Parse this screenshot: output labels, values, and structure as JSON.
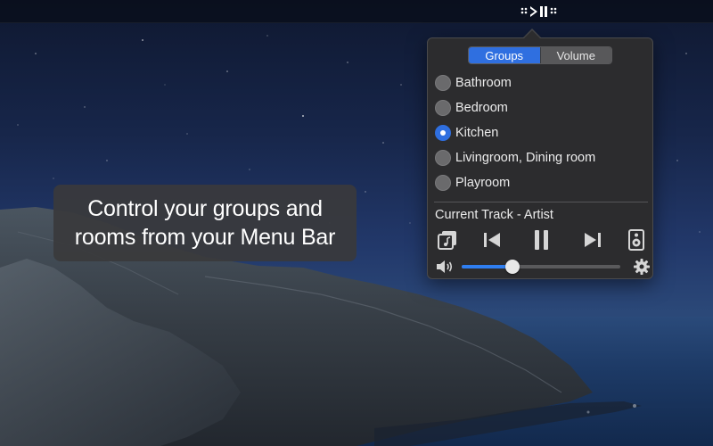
{
  "caption": {
    "line1": "Control your groups and",
    "line2": "rooms from your Menu Bar"
  },
  "menubar": {
    "icon": "play-pause-icon"
  },
  "popover": {
    "tabs": [
      {
        "label": "Groups",
        "active": true
      },
      {
        "label": "Volume",
        "active": false
      }
    ],
    "rooms": [
      {
        "label": "Bathroom",
        "selected": false
      },
      {
        "label": "Bedroom",
        "selected": false
      },
      {
        "label": "Kitchen",
        "selected": true
      },
      {
        "label": "Livingroom, Dining room",
        "selected": false
      },
      {
        "label": "Playroom",
        "selected": false
      }
    ],
    "now_playing": "Current Track - Artist",
    "controls": [
      "album-art-icon",
      "previous-track-icon",
      "pause-icon",
      "next-track-icon",
      "speaker-icon"
    ],
    "volume": {
      "icon": "volume-icon",
      "level": 0.32,
      "settings_icon": "gear-icon"
    }
  },
  "colors": {
    "accent": "#2f6fe0",
    "popover_bg": "#2c2c2e"
  }
}
